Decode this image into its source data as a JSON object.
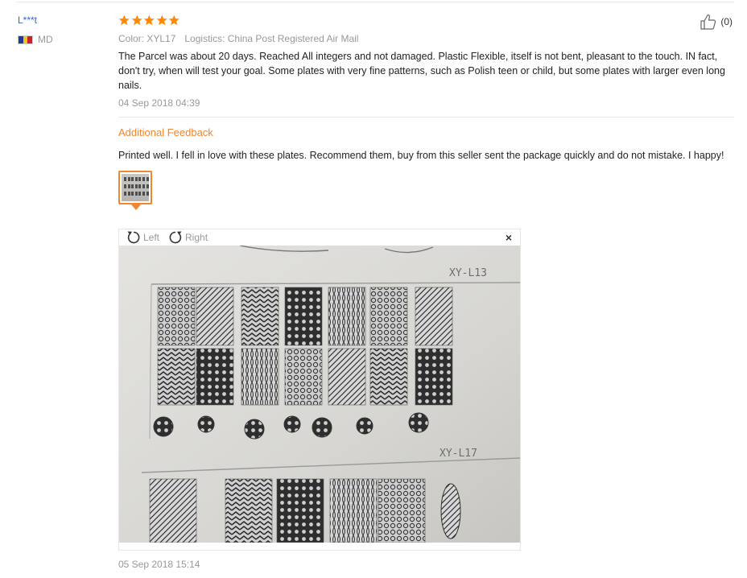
{
  "review": {
    "user_name": "L***t",
    "country_code": "MD",
    "rating": 5,
    "helpful_count": "(0)",
    "meta": {
      "color": "Color: XYL17",
      "logistics": "Logistics: China Post Registered Air Mail"
    },
    "text": "The Parcel was about 20 days. Reached All integers and not damaged. Plastic Flexible, itself is not bent, pleasant to the touch. IN fact, don't try, when will test your goal. Some plates with very fine patterns, such as Polish teen or child, but some plates with larger even long nails.",
    "date": "04 Sep 2018 04:39"
  },
  "additional_feedback": {
    "title": "Additional Feedback",
    "text": "Printed well. I fell in love with these plates. Recommend them, buy from this seller sent the package quickly and do not mistake. I happy!",
    "date": "05 Sep 2018 15:14"
  },
  "viewer": {
    "rotate_left_label": "Left",
    "rotate_right_label": "Right",
    "close_label": "×",
    "photo_labels": [
      "XY-L13",
      "XY-L17"
    ]
  },
  "colors": {
    "accent": "#f0862f",
    "star": "#ff8a00",
    "link": "#3366cc",
    "muted": "#999999"
  },
  "icons": [
    "star-icon",
    "thumbs-up-icon",
    "flag-icon",
    "rotate-left-icon",
    "rotate-right-icon",
    "close-icon"
  ]
}
